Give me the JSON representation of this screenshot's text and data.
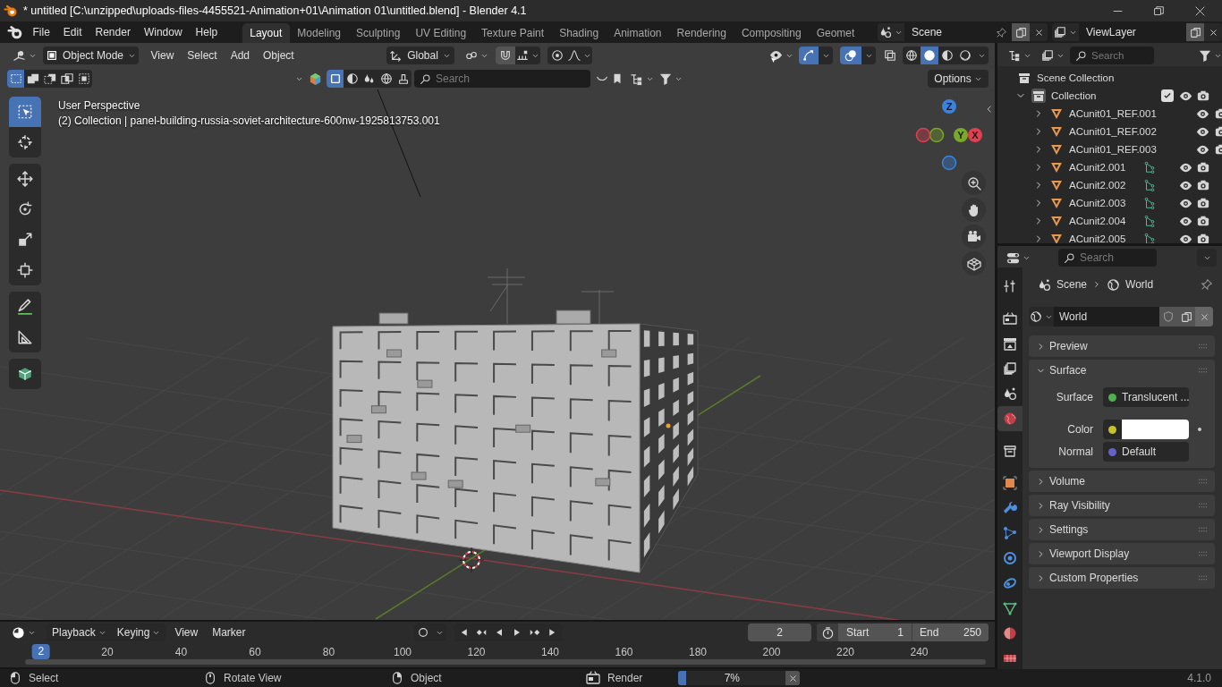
{
  "window": {
    "title": "* untitled [C:\\unzipped\\uploads-files-4455521-Animation+01\\Animation 01\\untitled.blend] - Blender 4.1"
  },
  "menu": [
    "File",
    "Edit",
    "Render",
    "Window",
    "Help"
  ],
  "workspaces": [
    {
      "label": "Layout",
      "selected": true
    },
    {
      "label": "Modeling",
      "selected": false
    },
    {
      "label": "Sculpting",
      "selected": false
    },
    {
      "label": "UV Editing",
      "selected": false
    },
    {
      "label": "Texture Paint",
      "selected": false
    },
    {
      "label": "Shading",
      "selected": false
    },
    {
      "label": "Animation",
      "selected": false
    },
    {
      "label": "Rendering",
      "selected": false
    },
    {
      "label": "Compositing",
      "selected": false
    },
    {
      "label": "Geomet",
      "selected": false
    }
  ],
  "scene_selector": {
    "value": "Scene"
  },
  "view_layer_selector": {
    "value": "ViewLayer"
  },
  "viewport": {
    "mode": "Object Mode",
    "menus": [
      "View",
      "Select",
      "Add",
      "Object"
    ],
    "orientation": "Global",
    "gizmos_on": true,
    "overlays_on": true,
    "xray_on": false,
    "shading": [
      {
        "kind": "wireframe",
        "selected": false
      },
      {
        "kind": "solid",
        "selected": true
      },
      {
        "kind": "material",
        "selected": false
      },
      {
        "kind": "rendered",
        "selected": false
      }
    ],
    "select_modes": [
      {
        "kind": "new",
        "selected": true
      },
      {
        "kind": "extend",
        "selected": false
      },
      {
        "kind": "subtract",
        "selected": false
      },
      {
        "kind": "invert",
        "selected": false
      },
      {
        "kind": "intersect",
        "selected": false
      }
    ],
    "display_filters": [
      {
        "kind": "square",
        "selected": true
      },
      {
        "kind": "sphere",
        "selected": false
      },
      {
        "kind": "drops",
        "selected": false
      },
      {
        "kind": "globe",
        "selected": false
      },
      {
        "kind": "brush",
        "selected": false
      }
    ],
    "search": {
      "placeholder": "Search"
    },
    "options": "Options",
    "info": [
      "User Perspective",
      "(2) Collection | panel-building-russia-soviet-architecture-600nw-1925813753.001"
    ],
    "tool_groups": [
      [
        {
          "kind": "select",
          "selected": true
        },
        {
          "kind": "cursor",
          "selected": false
        }
      ],
      [
        {
          "kind": "move",
          "selected": false
        },
        {
          "kind": "rotate",
          "selected": false
        },
        {
          "kind": "scale",
          "selected": false
        },
        {
          "kind": "transform",
          "selected": false
        }
      ],
      [
        {
          "kind": "annotate",
          "selected": false
        },
        {
          "kind": "measure",
          "selected": false
        }
      ],
      [
        {
          "kind": "add_cube",
          "selected": false
        }
      ]
    ],
    "gizmo_axes": [
      {
        "label": "Z",
        "color": "#3b82e0"
      },
      {
        "label": "Y",
        "color": "#7aa82a"
      },
      {
        "label": "X",
        "color": "#e0404f"
      }
    ]
  },
  "outliner": {
    "search": {
      "placeholder": "Search"
    },
    "tree": [
      {
        "name": "Scene Collection",
        "kind": "scene_collection",
        "children": [
          {
            "name": "Collection",
            "kind": "collection",
            "expanded": true,
            "checked": true,
            "children": [
              {
                "name": "ACunit01_REF.001",
                "kind": "mesh",
                "expanded": false,
                "vertex_groups": false
              },
              {
                "name": "ACunit01_REF.002",
                "kind": "mesh",
                "expanded": false,
                "vertex_groups": false
              },
              {
                "name": "ACunit01_REF.003",
                "kind": "mesh",
                "expanded": false,
                "vertex_groups": false
              },
              {
                "name": "ACunit2.001",
                "kind": "mesh",
                "expanded": false,
                "vertex_groups": true
              },
              {
                "name": "ACunit2.002",
                "kind": "mesh",
                "expanded": false,
                "vertex_groups": true
              },
              {
                "name": "ACunit2.003",
                "kind": "mesh",
                "expanded": false,
                "vertex_groups": true
              },
              {
                "name": "ACunit2.004",
                "kind": "mesh",
                "expanded": false,
                "vertex_groups": true
              },
              {
                "name": "ACunit2.005",
                "kind": "mesh",
                "expanded": false,
                "vertex_groups": true
              }
            ]
          }
        ]
      }
    ]
  },
  "properties": {
    "search": {
      "placeholder": "Search"
    },
    "tab_groups": [
      [
        {
          "kind": "tool",
          "selected": false
        }
      ],
      [
        {
          "kind": "render",
          "selected": false
        },
        {
          "kind": "output",
          "selected": false
        },
        {
          "kind": "view_layer",
          "selected": false
        },
        {
          "kind": "scene",
          "selected": false
        },
        {
          "kind": "world",
          "selected": true
        }
      ],
      [
        {
          "kind": "collection",
          "selected": false
        }
      ],
      [
        {
          "kind": "object",
          "selected": false
        },
        {
          "kind": "modifiers",
          "selected": false
        },
        {
          "kind": "particles",
          "selected": false
        },
        {
          "kind": "physics",
          "selected": false
        },
        {
          "kind": "constraints",
          "selected": false
        },
        {
          "kind": "data",
          "selected": false
        },
        {
          "kind": "material",
          "selected": false
        },
        {
          "kind": "texture",
          "selected": false
        }
      ]
    ],
    "breadcrumb": [
      {
        "kind": "scene",
        "label": "Scene"
      },
      {
        "kind": "world",
        "label": "World"
      }
    ],
    "datablock": "World",
    "panels": [
      {
        "title": "Preview",
        "expanded": false
      },
      {
        "title": "Surface",
        "expanded": true,
        "fields": [
          {
            "kind": "shader",
            "label": "Surface",
            "value": "Translucent ...",
            "color": "#4fb04f"
          },
          {
            "kind": "color",
            "label": "Color",
            "color": "#c7c129"
          },
          {
            "kind": "vector",
            "label": "Normal",
            "value": "Default",
            "color": "#6363c7"
          }
        ]
      },
      {
        "title": "Volume",
        "expanded": false
      },
      {
        "title": "Ray Visibility",
        "expanded": false
      },
      {
        "title": "Settings",
        "expanded": false
      },
      {
        "title": "Viewport Display",
        "expanded": false
      },
      {
        "title": "Custom Properties",
        "expanded": false
      }
    ]
  },
  "timeline": {
    "menus": [
      "Playback",
      "Keying",
      "View",
      "Marker"
    ],
    "current_frame": "2",
    "start_label": "Start",
    "start": "1",
    "end_label": "End",
    "end": "250",
    "ruler": [
      "20",
      "40",
      "60",
      "80",
      "100",
      "120",
      "140",
      "160",
      "180",
      "200",
      "220",
      "240"
    ],
    "playhead": "2"
  },
  "status_bar": {
    "hints": [
      {
        "kind": "left_mouse",
        "label": "Select"
      },
      {
        "kind": "middle_mouse",
        "label": "Rotate View"
      },
      {
        "kind": "right_mouse",
        "label": "Object"
      }
    ],
    "job": {
      "label": "Render",
      "progress": "7%",
      "level": 0.07
    },
    "version": "4.1.0"
  }
}
